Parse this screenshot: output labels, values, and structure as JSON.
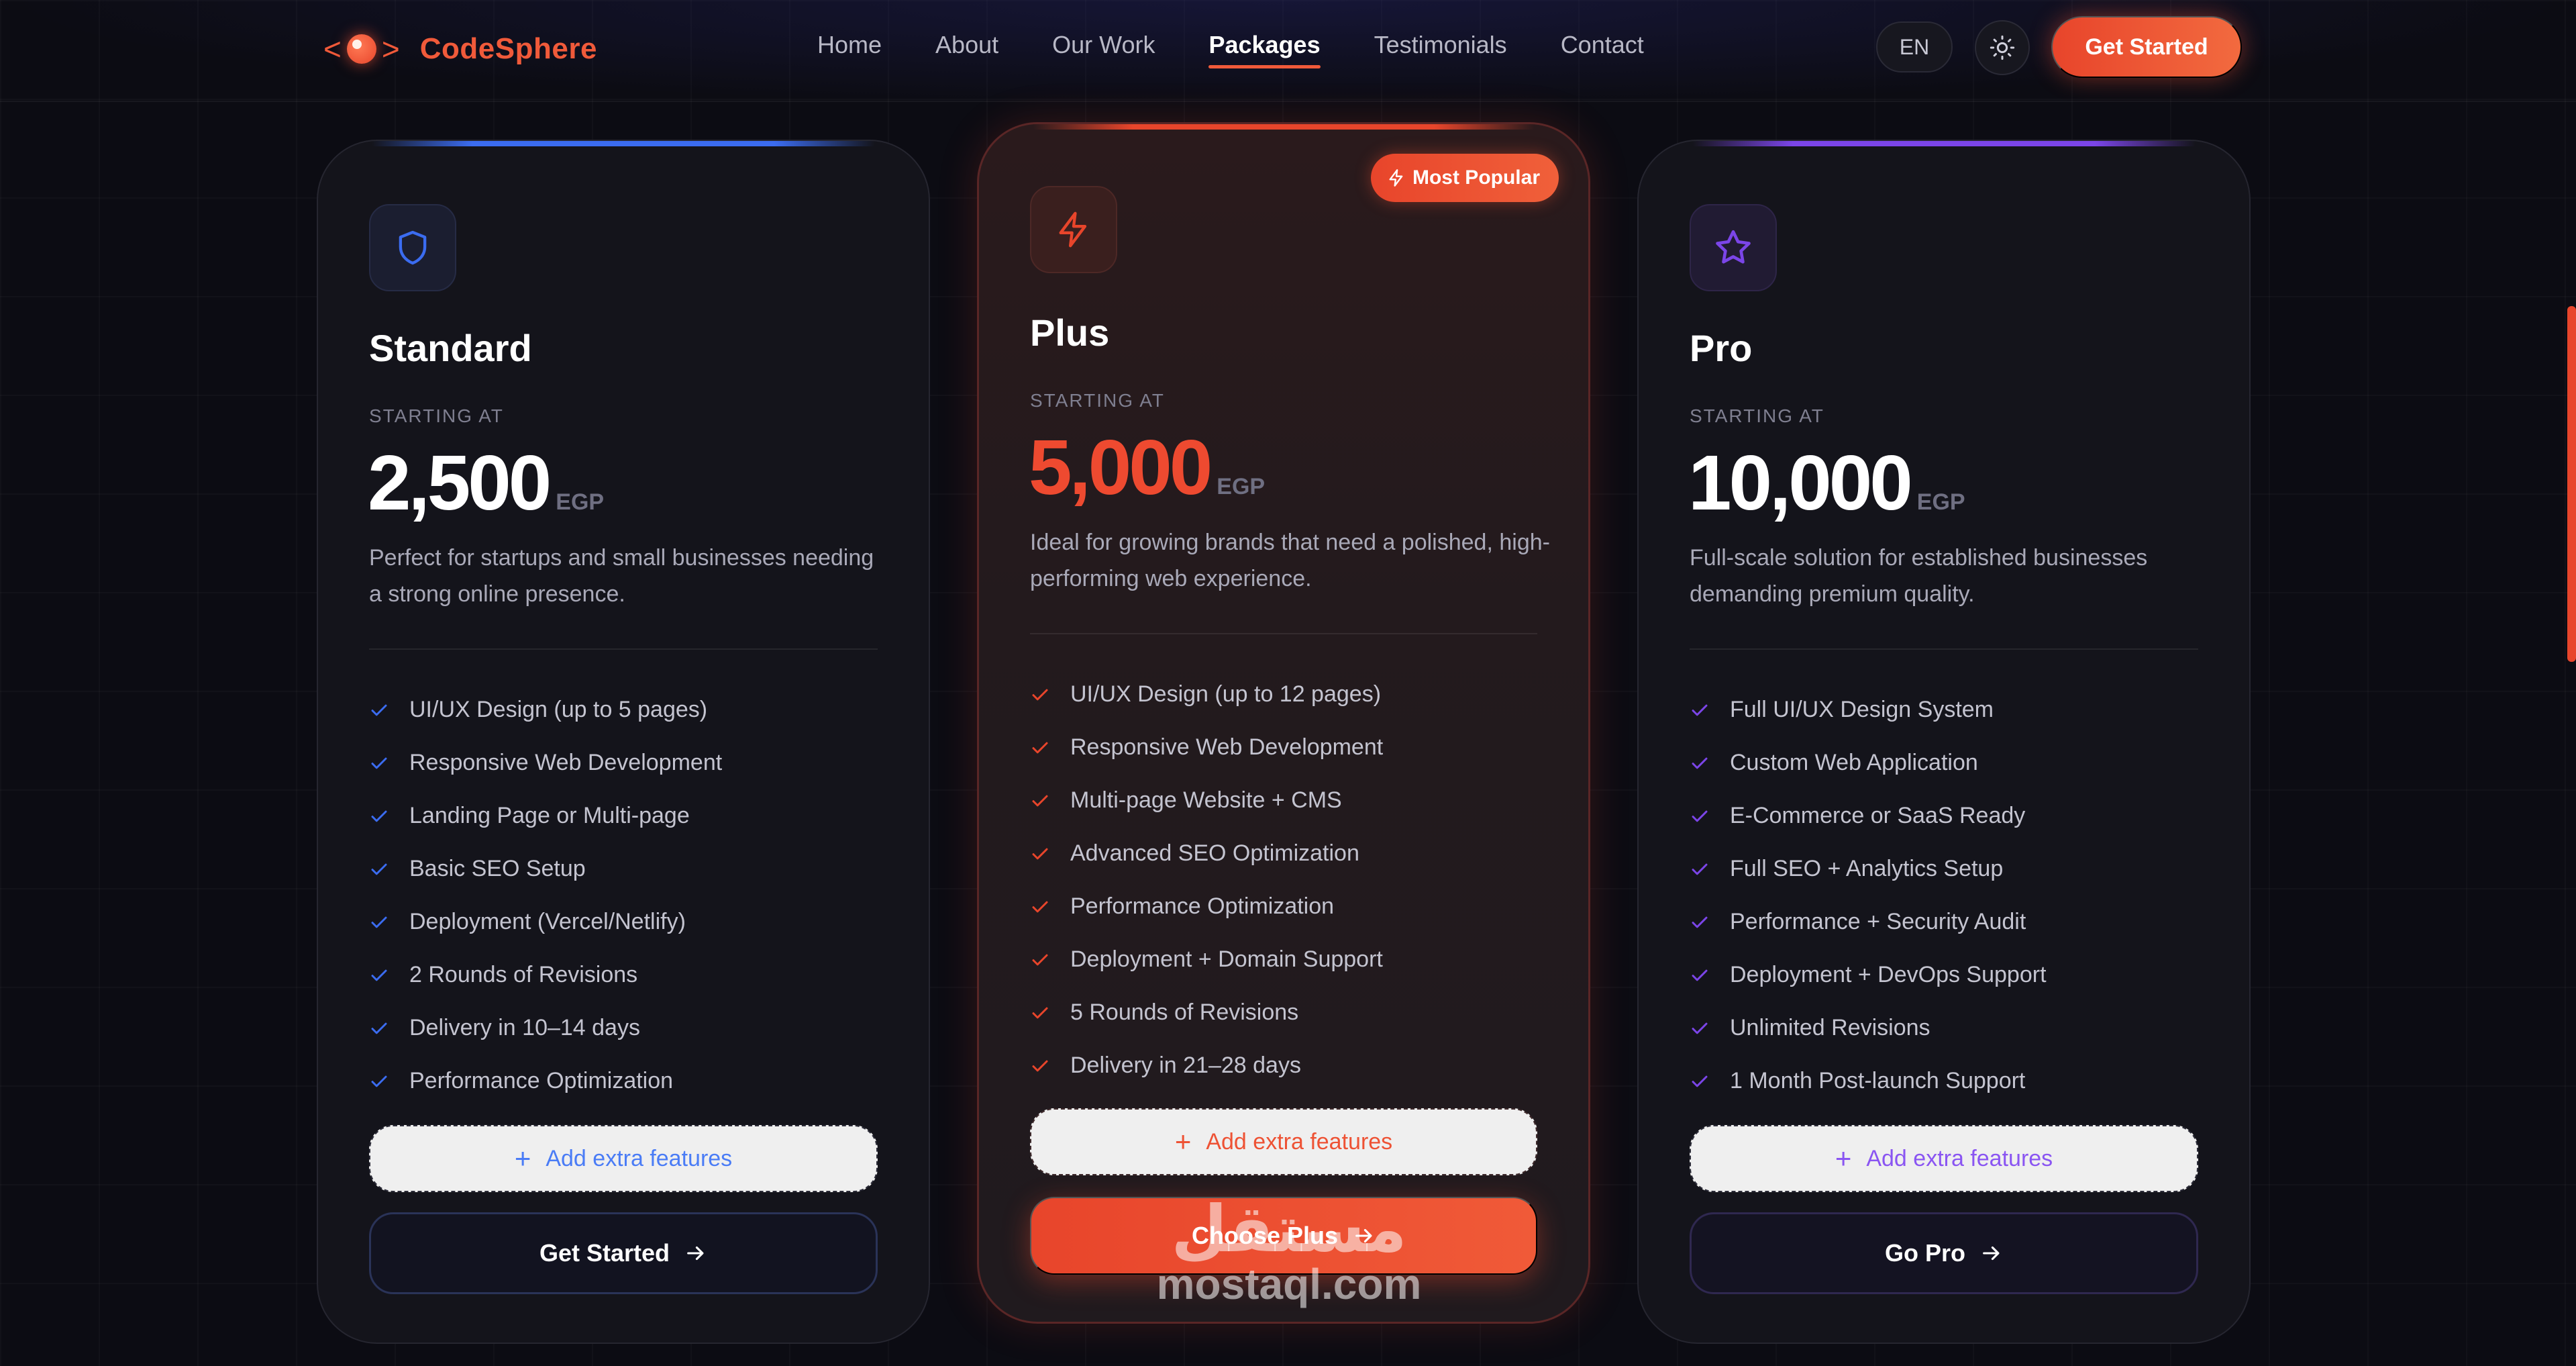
{
  "brand": {
    "name": "CodeSphere",
    "bracket_left": "<",
    "bracket_right": ">"
  },
  "nav": {
    "links": [
      {
        "label": "Home",
        "active": false
      },
      {
        "label": "About",
        "active": false
      },
      {
        "label": "Our Work",
        "active": false
      },
      {
        "label": "Packages",
        "active": true
      },
      {
        "label": "Testimonials",
        "active": false
      },
      {
        "label": "Contact",
        "active": false
      }
    ],
    "language": "EN",
    "cta": "Get Started"
  },
  "colors": {
    "accent": "#e8452b",
    "standard": "#3b6cf0",
    "plus": "#e8452b",
    "pro": "#7b45e8"
  },
  "packages": [
    {
      "icon": "shield-icon",
      "name": "Standard",
      "starting_label": "STARTING AT",
      "price": "2,500",
      "currency": "EGP",
      "description": "Perfect for startups and small businesses needing a strong online presence.",
      "features": [
        "UI/UX Design (up to 5 pages)",
        "Responsive Web Development",
        "Landing Page or Multi-page",
        "Basic SEO Setup",
        "Deployment (Vercel/Netlify)",
        "2 Rounds of Revisions",
        "Delivery in 10–14 days",
        "Performance Optimization"
      ],
      "extra_label": "Add extra features",
      "cta": "Get Started"
    },
    {
      "icon": "lightning-icon",
      "badge": "Most Popular",
      "name": "Plus",
      "starting_label": "STARTING AT",
      "price": "5,000",
      "currency": "EGP",
      "description": "Ideal for growing brands that need a polished, high-performing web experience.",
      "features": [
        "UI/UX Design (up to 12 pages)",
        "Responsive Web Development",
        "Multi-page Website + CMS",
        "Advanced SEO Optimization",
        "Performance Optimization",
        "Deployment + Domain Support",
        "5 Rounds of Revisions",
        "Delivery in 21–28 days"
      ],
      "extra_label": "Add extra features",
      "cta": "Choose Plus"
    },
    {
      "icon": "star-icon",
      "name": "Pro",
      "starting_label": "STARTING AT",
      "price": "10,000",
      "currency": "EGP",
      "description": "Full-scale solution for established businesses demanding premium quality.",
      "features": [
        "Full UI/UX Design System",
        "Custom Web Application",
        "E-Commerce or SaaS Ready",
        "Full SEO + Analytics Setup",
        "Performance + Security Audit",
        "Deployment + DevOps Support",
        "Unlimited Revisions",
        "1 Month Post-launch Support"
      ],
      "extra_label": "Add extra features",
      "cta": "Go Pro"
    }
  ],
  "watermark": {
    "arabic": "مستقل",
    "latin": "mostaql.com"
  }
}
